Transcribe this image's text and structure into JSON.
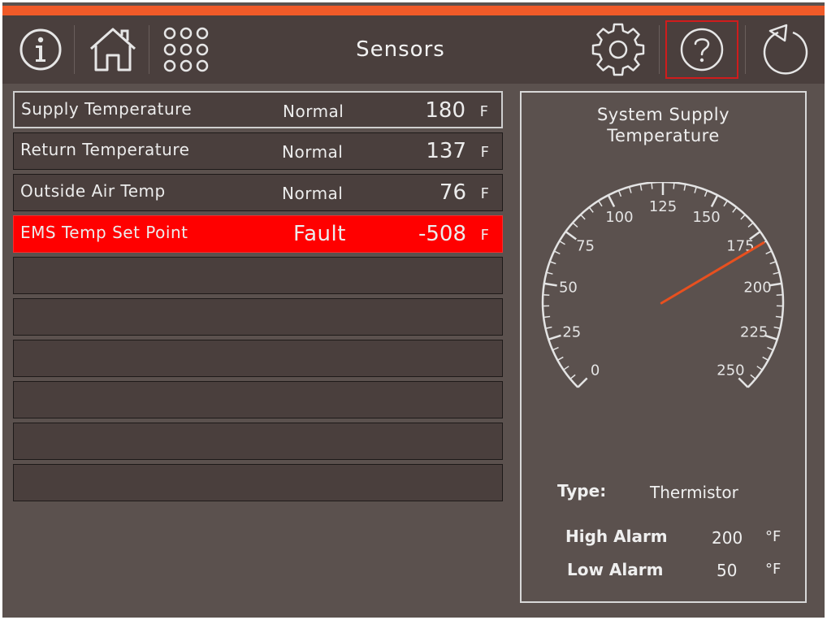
{
  "header": {
    "title": "Sensors",
    "accent_color": "#f05a28",
    "icons": [
      "info-icon",
      "home-icon",
      "apps-grid-icon",
      "gear-icon",
      "help-icon",
      "back-icon"
    ]
  },
  "sensors": [
    {
      "name": "Supply Temperature",
      "status": "Normal",
      "value": "180",
      "unit": "F"
    },
    {
      "name": "Return Temperature",
      "status": "Normal",
      "value": "137",
      "unit": "F"
    },
    {
      "name": "Outside Air Temp",
      "status": "Normal",
      "value": "76",
      "unit": "F"
    },
    {
      "name": "EMS Temp Set Point",
      "status": "Fault",
      "value": "-508",
      "unit": "F"
    }
  ],
  "fault_color": "#ff0000",
  "detail": {
    "title_line1": "System Supply",
    "title_line2": "Temperature",
    "gauge": {
      "min": 0,
      "max": 250,
      "value": 180,
      "tick_labels": [
        "0",
        "25",
        "50",
        "75",
        "100",
        "125",
        "150",
        "175",
        "200",
        "225",
        "250"
      ],
      "needle_color": "#e8501f"
    },
    "type_label": "Type:",
    "type_value": "Thermistor",
    "high_alarm_label": "High Alarm",
    "high_alarm_value": "200",
    "high_alarm_unit": "°F",
    "low_alarm_label": "Low Alarm",
    "low_alarm_value": "50",
    "low_alarm_unit": "°F"
  }
}
